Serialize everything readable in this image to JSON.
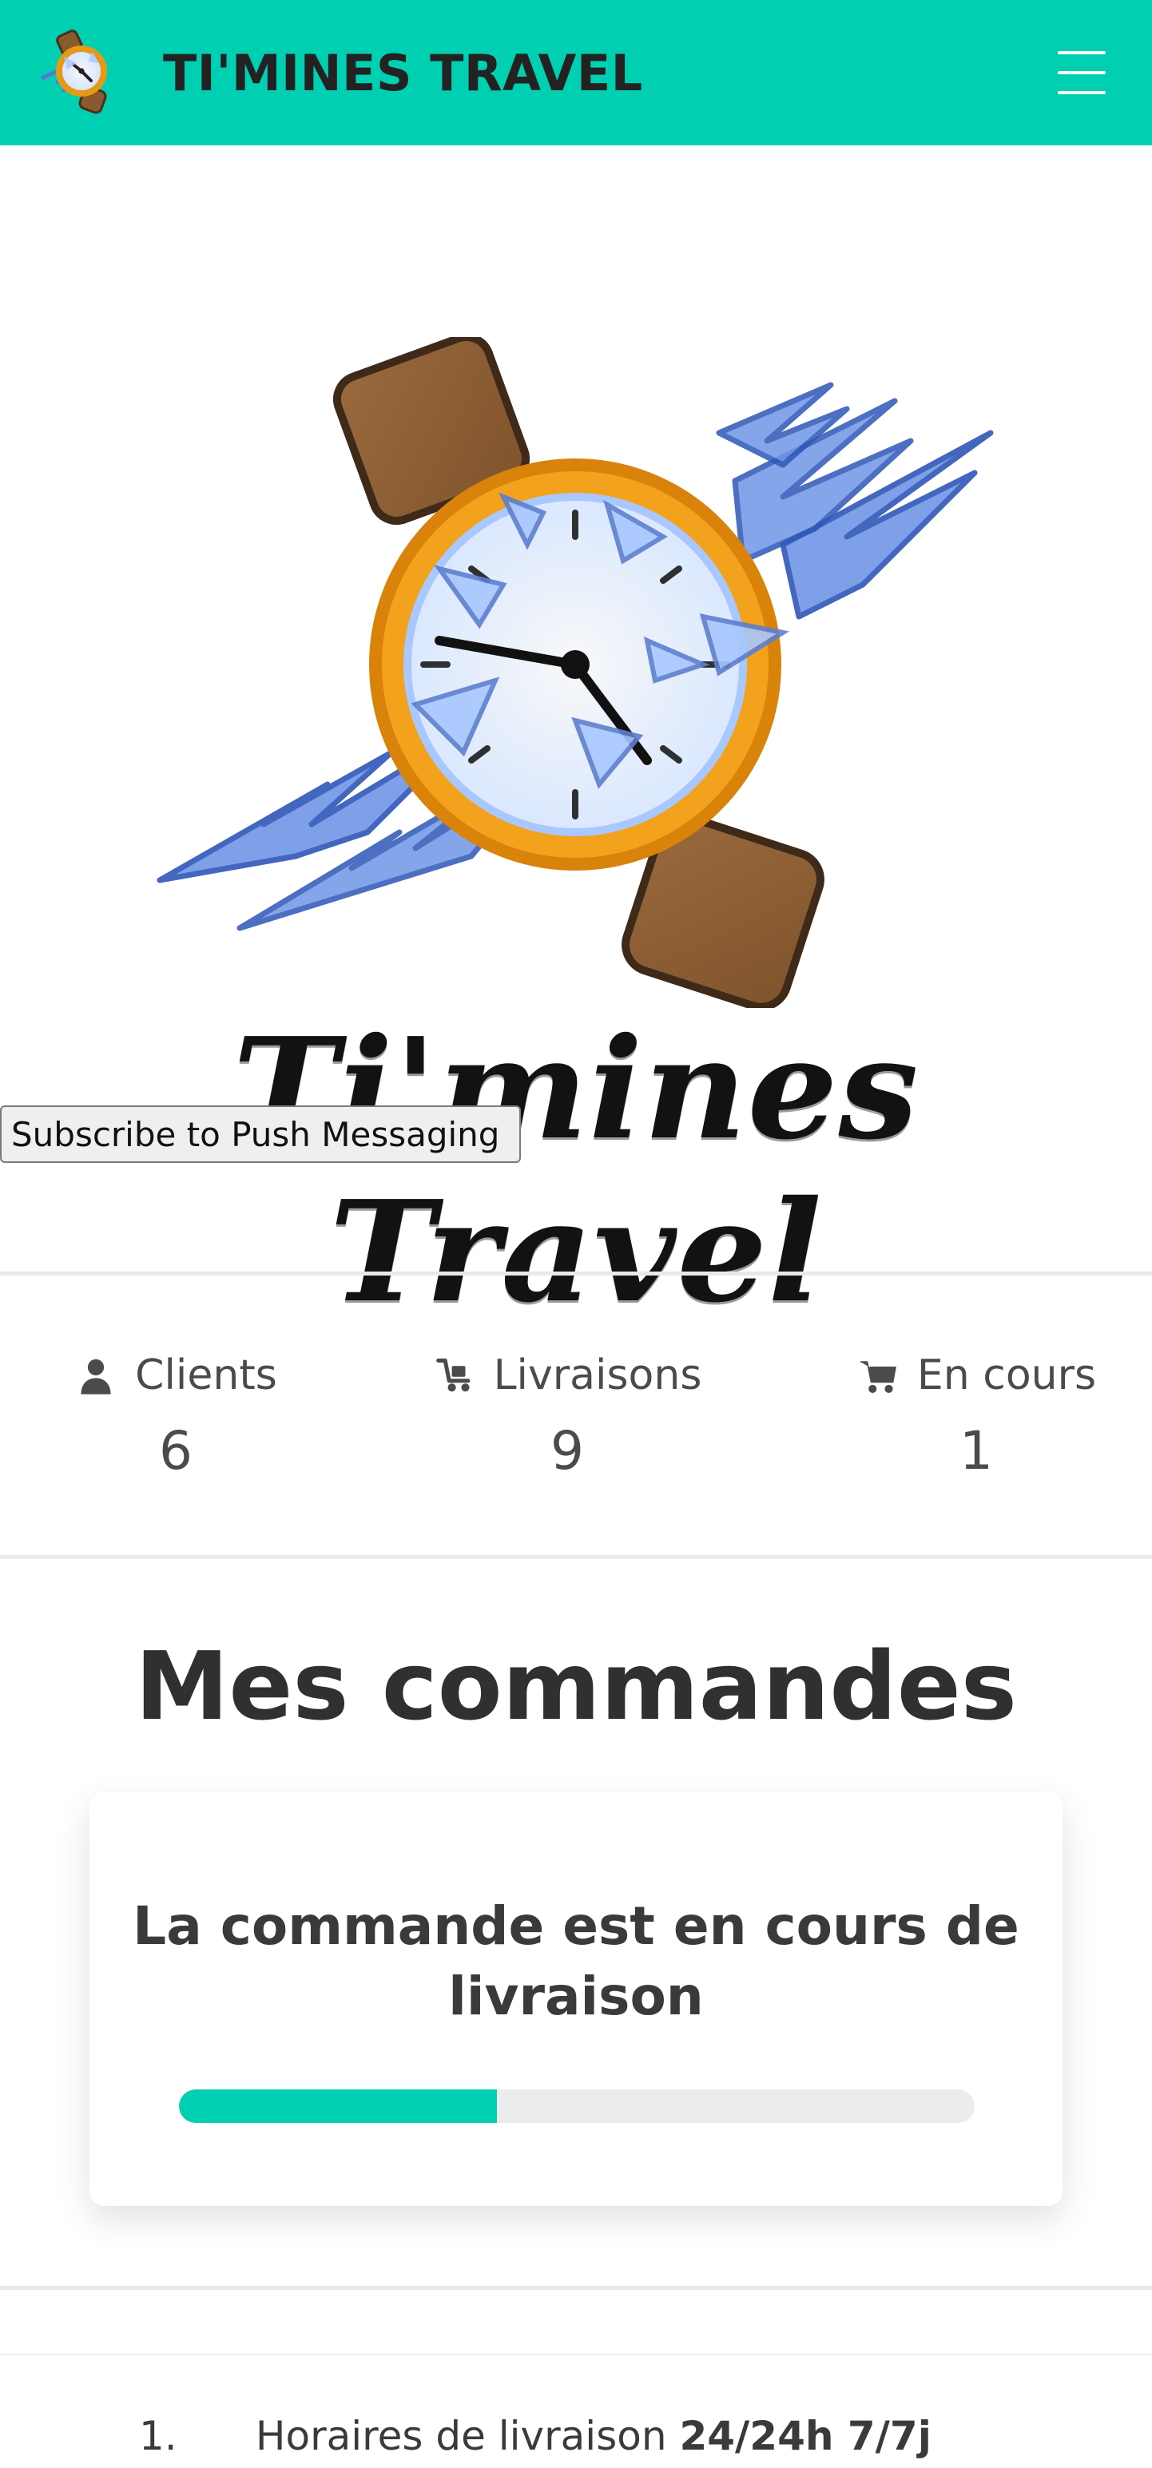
{
  "header": {
    "title": "TI'MINES TRAVEL",
    "icons": {
      "logo": "watch-icon",
      "menu": "hamburger-menu-icon"
    },
    "colors": {
      "primary": "#00cfb1"
    }
  },
  "hero": {
    "script_title": "Ti'mines Travel",
    "art_icon": "broken-watch-illustration"
  },
  "subscribe": {
    "label": "Subscribe to Push Messaging"
  },
  "stats": [
    {
      "label": "Clients",
      "value": "6",
      "icon": "user-icon"
    },
    {
      "label": "Livraisons",
      "value": "9",
      "icon": "delivery-cart-icon"
    },
    {
      "label": "En cours",
      "value": "1",
      "icon": "shopping-cart-icon"
    }
  ],
  "orders": {
    "title": "Mes commandes",
    "status_text": "La commande est en cours de livraison",
    "progress_percent": 40
  },
  "info": {
    "items": [
      {
        "number": "1.",
        "text": "Horaires de livraison",
        "strong": "24/24h 7/7j"
      }
    ]
  }
}
